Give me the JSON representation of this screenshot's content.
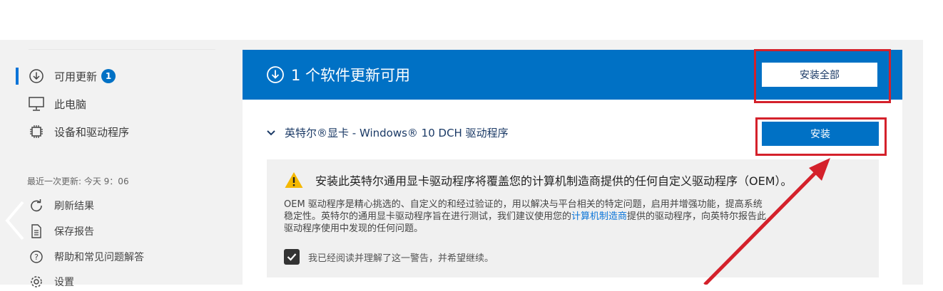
{
  "sidebar": {
    "items": [
      {
        "label": "可用更新",
        "icon": "download-circle-icon",
        "badge": "1"
      },
      {
        "label": "此电脑",
        "icon": "monitor-icon"
      },
      {
        "label": "设备和驱动程序",
        "icon": "chip-icon"
      }
    ],
    "last_update": "最近一次更新: 今天 9：06",
    "actions": [
      {
        "label": "刷新结果",
        "icon": "refresh-icon"
      },
      {
        "label": "保存报告",
        "icon": "document-icon"
      },
      {
        "label": "帮助和常见问题解答",
        "icon": "help-icon"
      },
      {
        "label": "设置",
        "icon": "gear-icon"
      }
    ]
  },
  "panel": {
    "header_title": "1 个软件更新可用",
    "install_all_label": "安装全部",
    "driver_name": "英特尔®显卡 - Windows® 10 DCH 驱动程序",
    "install_label": "安装",
    "warning": {
      "title": "安装此英特尔通用显卡驱动程序将覆盖您的计算机制造商提供的任何自定义驱动程序（OEM）。",
      "body_line1": "OEM 驱动程序是精心挑选的、自定义的和经过验证的，用以解决与平台相关的特定问题，启用并增强功能，提高系统",
      "body_line2_a": "稳定性。英特尔的通用显卡驱动程序旨在进行测试，我们建议使用您的",
      "body_line2_link": "计算机制造商",
      "body_line2_b": "提供的驱动程序，向英特尔报告此",
      "body_line3": "驱动程序使用中发现的任何问题。",
      "checkbox_label": "我已经阅读并理解了这一警告，并希望继续。",
      "checkbox_checked": true
    }
  },
  "colors": {
    "accent": "#0071c5",
    "highlight_red": "#d4212b",
    "warning_yellow": "#f5b800"
  }
}
